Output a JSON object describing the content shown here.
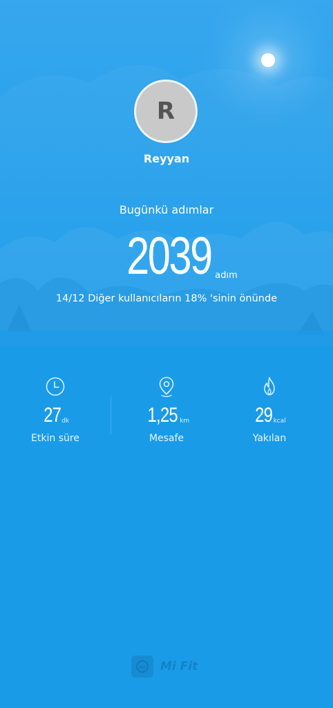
{
  "profile": {
    "avatar_letter": "R",
    "name": "Reyyan"
  },
  "today": {
    "label": "Bugünkü adımlar",
    "steps": "2039",
    "unit": "adım",
    "rank_text": "14/12 Diğer kullanıcıların 18% 'sinin önünde"
  },
  "stats": {
    "active": {
      "icon": "clock-icon",
      "value": "27",
      "unit": "dk",
      "label": "Etkin süre"
    },
    "distance": {
      "icon": "location-pin-icon",
      "value": "1,25",
      "unit": "km",
      "label": "Mesafe"
    },
    "calories": {
      "icon": "flame-icon",
      "value": "29",
      "unit": "kcal",
      "label": "Yakılan"
    }
  },
  "brand": {
    "name": "Mi Fit",
    "icon_text": "mi"
  },
  "colors": {
    "background": "#1a9be8",
    "text": "#ffffff"
  }
}
